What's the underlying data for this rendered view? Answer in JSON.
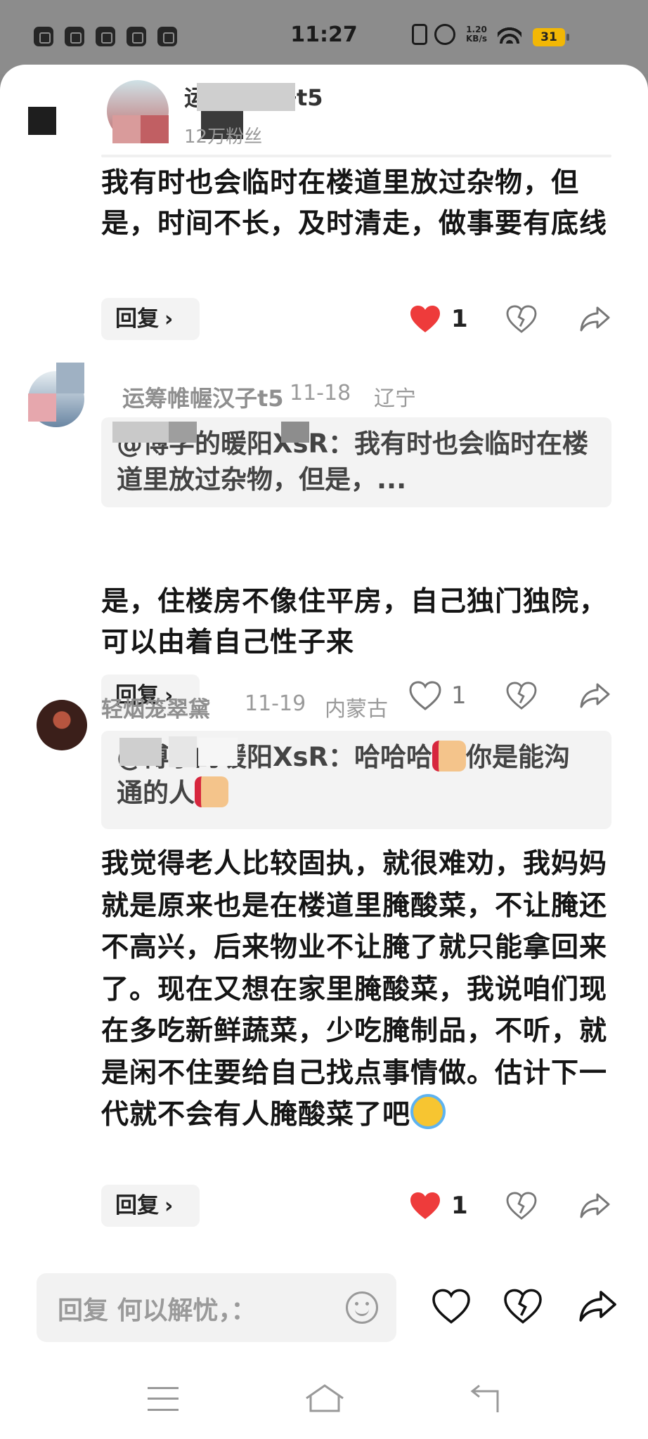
{
  "status_bar": {
    "time": "11:27",
    "net_speed": "1.20\nKB/s",
    "battery": "31",
    "left_icons": [
      "close-app-icon",
      "tiktok-icon",
      "mail-icon",
      "video-icon",
      "game-icon"
    ]
  },
  "comments": [
    {
      "author": "运筹帷幄子t5",
      "sub": "12万粉丝",
      "body": "我有时也会临时在楼道里放过杂物，但是，时间不长，及时清走，做事要有底线",
      "reply_label": "回复",
      "likes": "1",
      "liked": true
    },
    {
      "author": "运筹帷幄汉子t5",
      "date": "11-18",
      "location": "辽宁",
      "quote": "@博学的暖阳XsR：我有时也会临时在楼道里放过杂物，但是，...",
      "body": "是，住楼房不像住平房，自己独门独院，可以由着自己性子来",
      "reply_label": "回复",
      "likes": "1",
      "liked": false
    },
    {
      "author": "轻烟笼翠黛",
      "date": "11-19",
      "location": "内蒙古",
      "quote_part1": "@博学的暖阳XsR：哈哈哈",
      "quote_part2": "你是能沟通的人",
      "body": "我觉得老人比较固执，就很难劝，我妈妈就是原来也是在楼道里腌酸菜，不让腌还不高兴，后来物业不让腌了就只能拿回来了。现在又想在家里腌酸菜，我说咱们现在多吃新鲜蔬菜，少吃腌制品，不听，就是闲不住要给自己找点事情做。估计下一代就不会有人腌酸菜了吧",
      "reply_label": "回复",
      "likes": "1",
      "liked": true
    }
  ],
  "input": {
    "placeholder": "回复 何以解忧，："
  },
  "colors": {
    "like_red": "#ee3b3b",
    "icon_gray": "#777777"
  }
}
